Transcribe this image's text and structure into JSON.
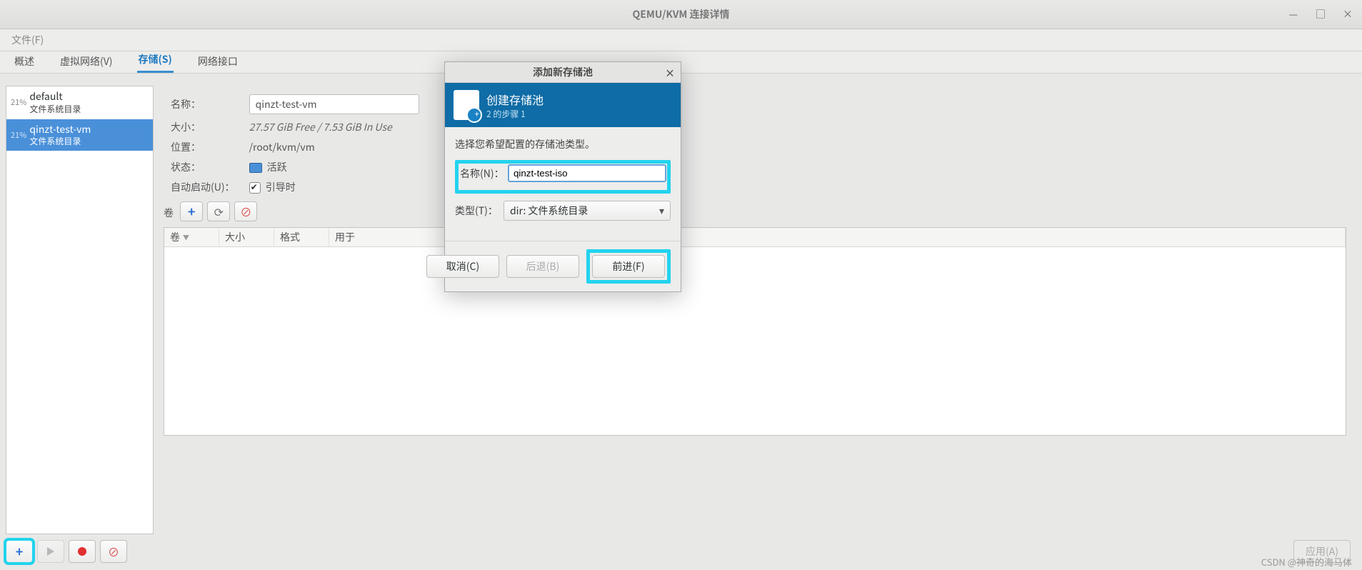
{
  "window": {
    "title": "QEMU/KVM 连接详情",
    "minimize": "—",
    "maximize": "□",
    "close": "×"
  },
  "menubar": {
    "file": "文件(F)"
  },
  "tabs": {
    "overview": "概述",
    "virtnet": "虚拟网络(V)",
    "storage": "存储(S)",
    "netif": "网络接口"
  },
  "pools": [
    {
      "pct": "21%",
      "name": "default",
      "sub": "文件系统目录",
      "selected": false
    },
    {
      "pct": "21%",
      "name": "qinzt-test-vm",
      "sub": "文件系统目录",
      "selected": true
    }
  ],
  "detail": {
    "name_lbl": "名称：",
    "name_val": "qinzt-test-vm",
    "size_lbl": "大小：",
    "size_val": "27.57 GiB Free / 7.53 GiB In Use",
    "loc_lbl": "位置：",
    "loc_val": "/root/kvm/vm",
    "state_lbl": "状态：",
    "state_val": "活跃",
    "auto_lbl": "自动启动(U)：",
    "auto_val": "引导时",
    "vol_lbl": "卷"
  },
  "vol_cols": {
    "c1": "卷",
    "c2": "大小",
    "c3": "格式",
    "c4": "用于"
  },
  "modal": {
    "title": "添加新存储池",
    "close": "×",
    "banner_head": "创建存储池",
    "banner_sub": "2 的步骤 1",
    "hint": "选择您希望配置的存储池类型。",
    "name_lbl": "名称(N)：",
    "name_val": "qinzt-test-iso",
    "type_lbl": "类型(T)：",
    "type_val": "dir: 文件系统目录",
    "cancel": "取消(C)",
    "back": "后退(B)",
    "forward": "前进(F)"
  },
  "apply_btn": "应用(A)",
  "watermark": "CSDN @神奇的海马体"
}
